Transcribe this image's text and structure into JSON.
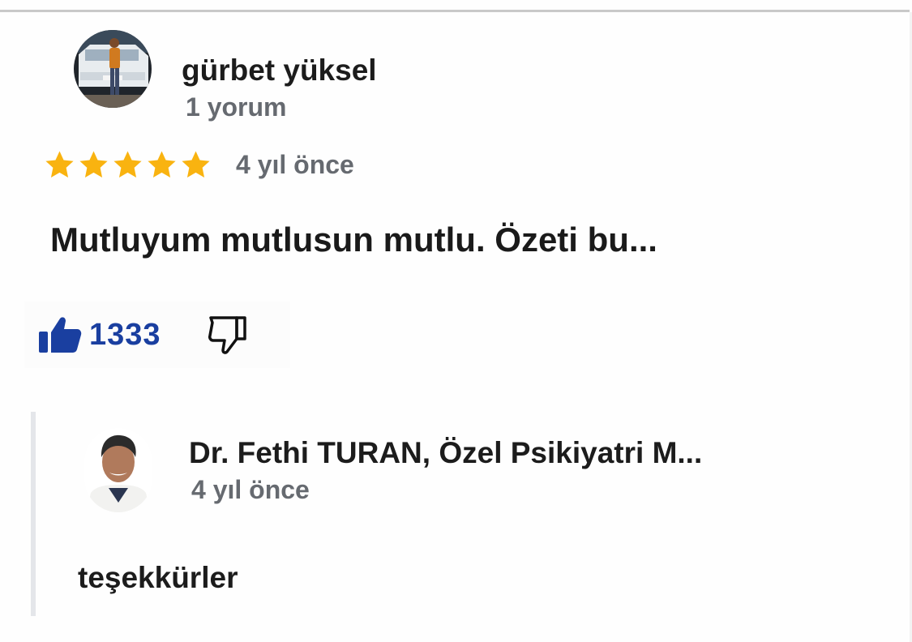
{
  "review": {
    "author": {
      "name": "gürbet yüksel",
      "review_count": "1 yorum",
      "avatar_icon": "avatar-photo"
    },
    "rating": 5,
    "max_rating": 5,
    "star_color": "#f9b310",
    "time": "4 yıl önce",
    "text": "Mutluyum mutlusun mutlu. Özeti bu...",
    "likes": "1333",
    "like_icon": "thumbs-up-icon",
    "dislike_icon": "thumbs-down-icon",
    "like_color": "#1a3fa0"
  },
  "reply": {
    "author": {
      "name": "Dr. Fethi TURAN, Özel Psikiyatri M...",
      "avatar_icon": "avatar-photo"
    },
    "time": "4 yıl önce",
    "text": "teşekkürler"
  }
}
